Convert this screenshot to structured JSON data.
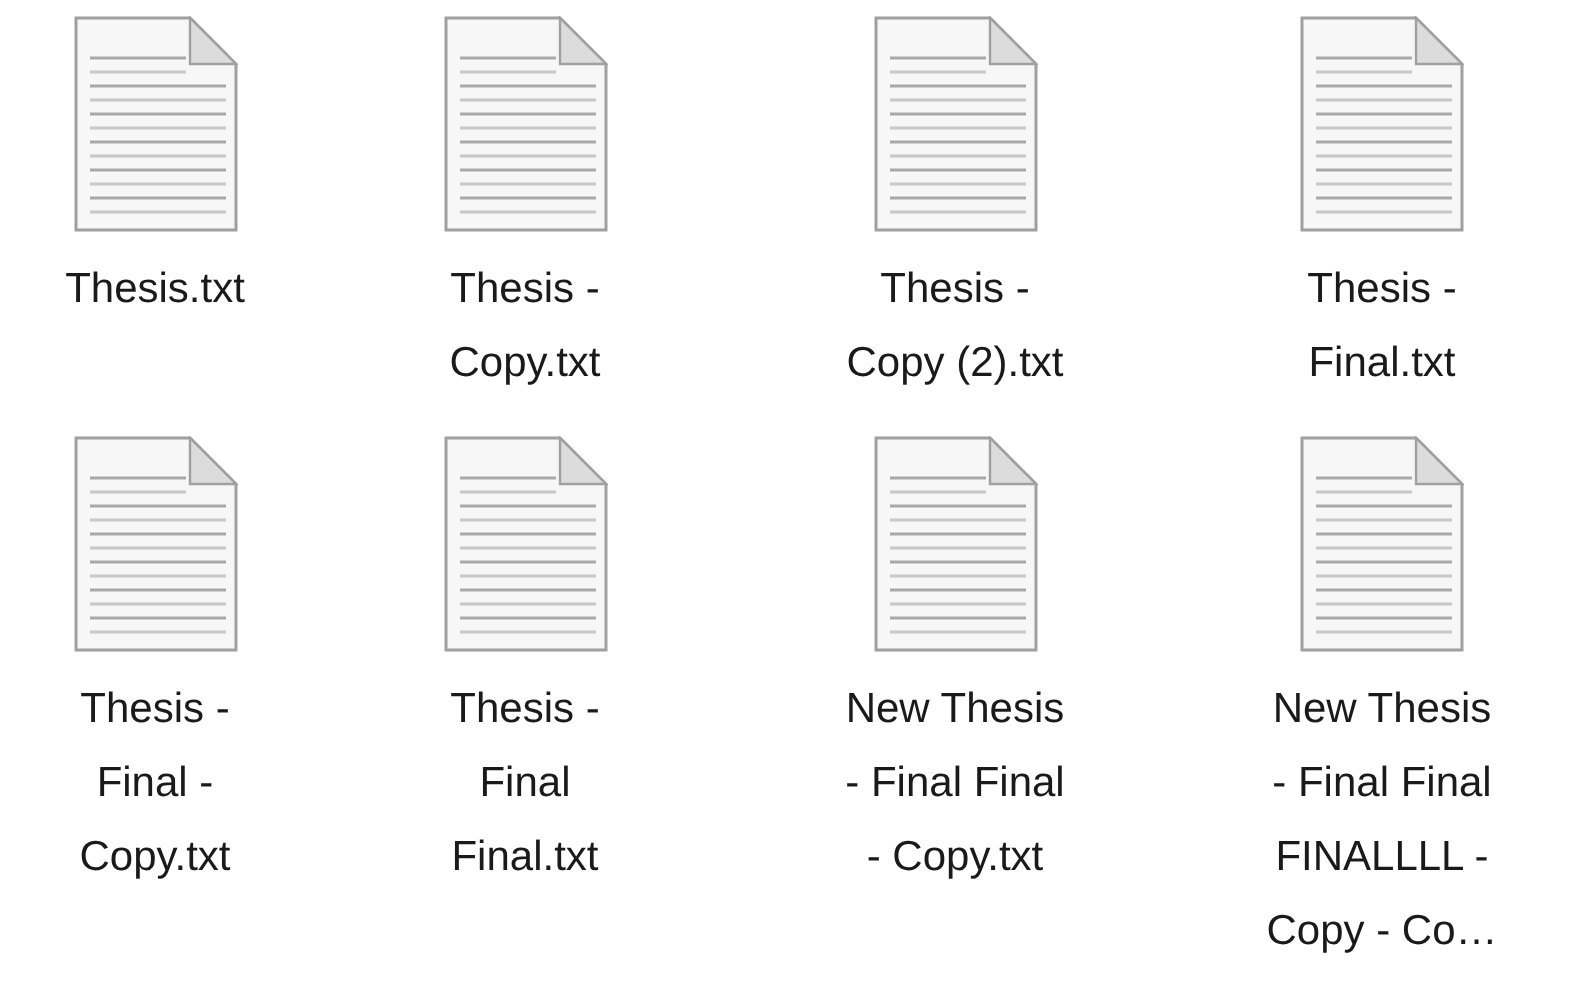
{
  "files": [
    {
      "name_lines": [
        "Thesis.txt"
      ]
    },
    {
      "name_lines": [
        "Thesis -",
        "Copy.txt"
      ]
    },
    {
      "name_lines": [
        "Thesis -",
        "Copy (2).txt"
      ]
    },
    {
      "name_lines": [
        "Thesis -",
        "Final.txt"
      ]
    },
    {
      "name_lines": [
        "Thesis -",
        "Final -",
        "Copy.txt"
      ]
    },
    {
      "name_lines": [
        "Thesis -",
        "Final",
        "Final.txt"
      ]
    },
    {
      "name_lines": [
        "New Thesis",
        "- Final Final",
        "- Copy.txt"
      ]
    },
    {
      "name_lines": [
        "New Thesis",
        "- Final Final",
        "FINALLLL -",
        "Copy - Co…"
      ]
    }
  ]
}
